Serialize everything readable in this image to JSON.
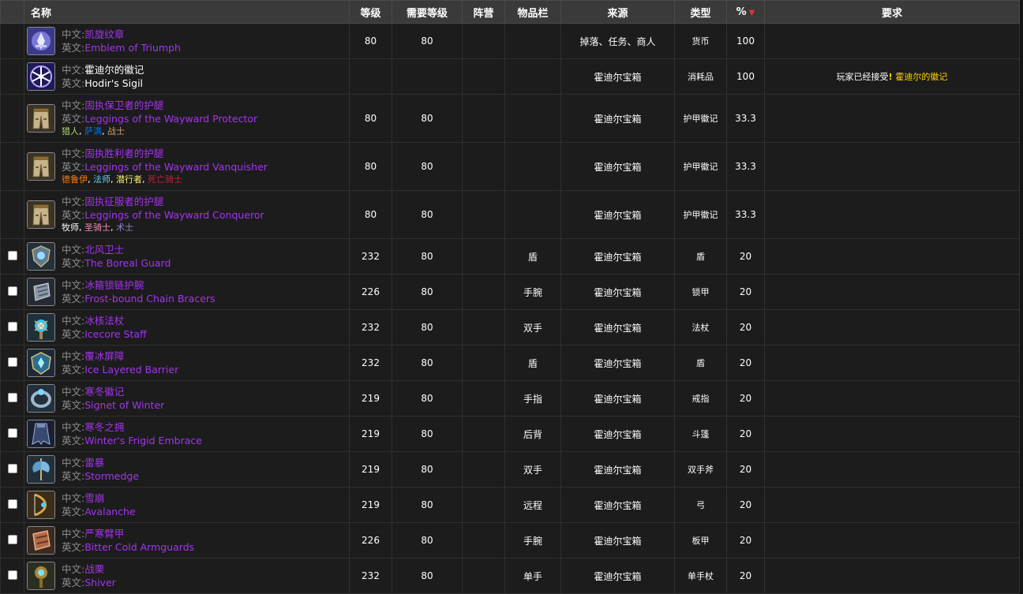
{
  "headers": {
    "name": "名称",
    "level": "等级",
    "req_level": "需要等级",
    "faction": "阵营",
    "slot": "物品栏",
    "source": "来源",
    "type": "类型",
    "percent": "%",
    "requirements": "要求"
  },
  "labels": {
    "cn": "中文:",
    "en": "英文:"
  },
  "colors": {
    "epic": "#a335ee",
    "hunter": "#abd473",
    "shaman": "#0070de",
    "warrior": "#c79c6e",
    "druid": "#ff7d0a",
    "mage": "#69ccf0",
    "rogue": "#fff569",
    "deathknight": "#c41f3b",
    "priest": "#ffffff",
    "paladin": "#f58cba",
    "warlock": "#9482c9"
  },
  "rows": [
    {
      "icon": "emblem-icon",
      "cn": "凯旋纹章",
      "en": "Emblem of Triumph",
      "quality": "epic",
      "level": "80",
      "req": "80",
      "faction": "",
      "slot": "",
      "source": "掉落、任务、商人",
      "type": "货币",
      "pct": "100",
      "checkbox": false,
      "classes": []
    },
    {
      "icon": "sigil-icon",
      "cn": "霍迪尔的徽记",
      "en": "Hodir's Sigil",
      "quality": "common",
      "level": "",
      "req": "",
      "faction": "",
      "slot": "",
      "source": "霍迪尔宝箱",
      "type": "消耗品",
      "pct": "100",
      "checkbox": false,
      "classes": [],
      "requirement": {
        "prefix": "玩家已经接受",
        "mark": "!",
        "link": "霍迪尔的徽记"
      }
    },
    {
      "icon": "leggings-icon",
      "cn": "固执保卫者的护腿",
      "en": "Leggings of the Wayward Protector",
      "quality": "epic",
      "level": "80",
      "req": "80",
      "faction": "",
      "slot": "",
      "source": "霍迪尔宝箱",
      "type": "护甲徽记",
      "pct": "33.3",
      "checkbox": false,
      "classes": [
        {
          "name": "猎人",
          "color": "#abd473"
        },
        {
          "name": "萨满",
          "color": "#0070de"
        },
        {
          "name": "战士",
          "color": "#c79c6e"
        }
      ]
    },
    {
      "icon": "leggings-icon",
      "cn": "固执胜利者的护腿",
      "en": "Leggings of the Wayward Vanquisher",
      "quality": "epic",
      "level": "80",
      "req": "80",
      "faction": "",
      "slot": "",
      "source": "霍迪尔宝箱",
      "type": "护甲徽记",
      "pct": "33.3",
      "checkbox": false,
      "classes": [
        {
          "name": "德鲁伊",
          "color": "#ff7d0a"
        },
        {
          "name": "法师",
          "color": "#69ccf0"
        },
        {
          "name": "潜行者",
          "color": "#fff569"
        },
        {
          "name": "死亡骑士",
          "color": "#c41f3b"
        }
      ]
    },
    {
      "icon": "leggings-icon",
      "cn": "固执征服者的护腿",
      "en": "Leggings of the Wayward Conqueror",
      "quality": "epic",
      "level": "80",
      "req": "80",
      "faction": "",
      "slot": "",
      "source": "霍迪尔宝箱",
      "type": "护甲徽记",
      "pct": "33.3",
      "checkbox": false,
      "classes": [
        {
          "name": "牧师",
          "color": "#ffffff"
        },
        {
          "name": "圣骑士",
          "color": "#f58cba"
        },
        {
          "name": "术士",
          "color": "#9482c9"
        }
      ]
    },
    {
      "icon": "shield-icon",
      "cn": "北风卫士",
      "en": "The Boreal Guard",
      "quality": "epic",
      "level": "232",
      "req": "80",
      "faction": "",
      "slot": "盾",
      "source": "霍迪尔宝箱",
      "type": "盾",
      "pct": "20",
      "checkbox": true,
      "classes": []
    },
    {
      "icon": "bracers-icon",
      "cn": "冰箍锁链护腕",
      "en": "Frost-bound Chain Bracers",
      "quality": "epic",
      "level": "226",
      "req": "80",
      "faction": "",
      "slot": "手腕",
      "source": "霍迪尔宝箱",
      "type": "锁甲",
      "pct": "20",
      "checkbox": true,
      "classes": []
    },
    {
      "icon": "staff-icon",
      "cn": "冰核法杖",
      "en": "Icecore Staff",
      "quality": "epic",
      "level": "232",
      "req": "80",
      "faction": "",
      "slot": "双手",
      "source": "霍迪尔宝箱",
      "type": "法杖",
      "pct": "20",
      "checkbox": true,
      "classes": []
    },
    {
      "icon": "barrier-icon",
      "cn": "覆冰屏障",
      "en": "Ice Layered Barrier",
      "quality": "epic",
      "level": "232",
      "req": "80",
      "faction": "",
      "slot": "盾",
      "source": "霍迪尔宝箱",
      "type": "盾",
      "pct": "20",
      "checkbox": true,
      "classes": []
    },
    {
      "icon": "ring-icon",
      "cn": "寒冬徽记",
      "en": "Signet of Winter",
      "quality": "epic",
      "level": "219",
      "req": "80",
      "faction": "",
      "slot": "手指",
      "source": "霍迪尔宝箱",
      "type": "戒指",
      "pct": "20",
      "checkbox": true,
      "classes": []
    },
    {
      "icon": "cloak-icon",
      "cn": "寒冬之拥",
      "en": "Winter's Frigid Embrace",
      "quality": "epic",
      "level": "219",
      "req": "80",
      "faction": "",
      "slot": "后背",
      "source": "霍迪尔宝箱",
      "type": "斗篷",
      "pct": "20",
      "checkbox": true,
      "classes": []
    },
    {
      "icon": "axe-icon",
      "cn": "雷暴",
      "en": "Stormedge",
      "quality": "epic",
      "level": "219",
      "req": "80",
      "faction": "",
      "slot": "双手",
      "source": "霍迪尔宝箱",
      "type": "双手斧",
      "pct": "20",
      "checkbox": true,
      "classes": []
    },
    {
      "icon": "bow-icon",
      "cn": "雪崩",
      "en": "Avalanche",
      "quality": "epic",
      "level": "219",
      "req": "80",
      "faction": "",
      "slot": "远程",
      "source": "霍迪尔宝箱",
      "type": "弓",
      "pct": "20",
      "checkbox": true,
      "classes": []
    },
    {
      "icon": "armguards-icon",
      "cn": "严寒臂甲",
      "en": "Bitter Cold Armguards",
      "quality": "epic",
      "level": "226",
      "req": "80",
      "faction": "",
      "slot": "手腕",
      "source": "霍迪尔宝箱",
      "type": "板甲",
      "pct": "20",
      "checkbox": true,
      "classes": []
    },
    {
      "icon": "scepter-icon",
      "cn": "战栗",
      "en": "Shiver",
      "quality": "epic",
      "level": "232",
      "req": "80",
      "faction": "",
      "slot": "单手",
      "source": "霍迪尔宝箱",
      "type": "单手杖",
      "pct": "20",
      "checkbox": true,
      "classes": []
    }
  ]
}
